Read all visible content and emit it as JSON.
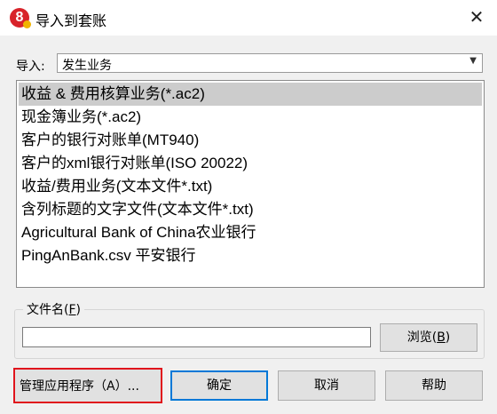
{
  "window": {
    "title": "导入到套账",
    "close_glyph": "✕",
    "icon_letter": "8"
  },
  "import": {
    "label": "导入:",
    "selected": "发生业务"
  },
  "list": {
    "items": [
      "收益 & 费用核算业务(*.ac2)",
      "现金簿业务(*.ac2)",
      "客户的银行对账单(MT940)",
      "客户的xml银行对账单(ISO 20022)",
      "收益/费用业务(文本文件*.txt)",
      "含列标题的文字文件(文本文件*.txt)",
      "Agricultural Bank of China农业银行",
      "PingAnBank.csv 平安银行"
    ],
    "selected_index": 0
  },
  "file": {
    "group_label_pre": "文件名(",
    "group_label_key": "F",
    "group_label_post": ")",
    "value": "",
    "browse_pre": "浏览(",
    "browse_key": "B",
    "browse_post": ")"
  },
  "buttons": {
    "manage": "管理应用程序（A）...",
    "ok": "确定",
    "cancel": "取消",
    "help": "帮助"
  }
}
